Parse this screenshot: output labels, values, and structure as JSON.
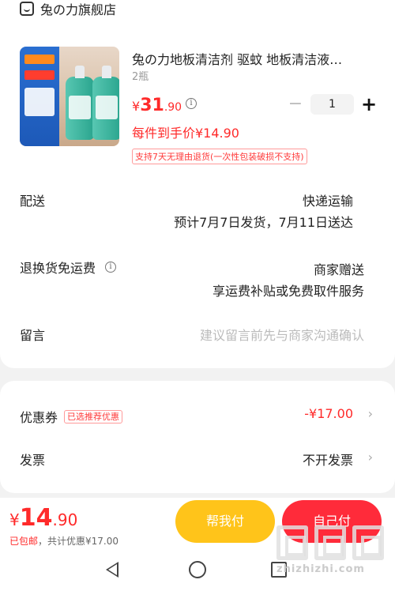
{
  "shop": {
    "name": "兔の力旗舰店"
  },
  "product": {
    "title": "兔の力地板清洁剂 驱蚊 地板清洁液…",
    "spec": "2瓶",
    "price_symbol": "¥",
    "price_int": "31",
    "price_dec": ".90",
    "quantity": "1",
    "minus": "−",
    "plus": "+",
    "unit_price": "每件到手价¥14.90",
    "policy": "支持7天无理由退货(一次性包装破损不支持)"
  },
  "delivery": {
    "label": "配送",
    "method": "快递运输",
    "schedule": "预计7月7日发货，7月11日送达"
  },
  "returns": {
    "label": "退换货免运费",
    "value": "商家赠送",
    "detail": "享运费补贴或免费取件服务"
  },
  "message": {
    "label": "留言",
    "placeholder": "建议留言前先与商家沟通确认"
  },
  "coupon": {
    "label": "优惠券",
    "tag": "已选推荐优惠",
    "value": "-¥17.00"
  },
  "invoice": {
    "label": "发票",
    "value": "不开发票"
  },
  "footer": {
    "symbol": "¥",
    "total_int": "14",
    "total_dec": ".90",
    "shipping": "已包邮",
    "discount": "，共计优惠¥17.00",
    "help_pay": "帮我付",
    "self_pay": "自己付"
  },
  "watermark": {
    "site": "zhizhizhi.com"
  },
  "colors": {
    "accent_red": "#ff2a2a",
    "help_button": "#ffc41a",
    "pay_button": "#ff2b3a"
  },
  "icons": {
    "shop": "shop-icon",
    "info": "info-icon",
    "chevron": "chevron-right-icon",
    "nav_back": "back-triangle-icon",
    "nav_home": "home-circle-icon",
    "nav_recent": "recent-square-icon"
  }
}
